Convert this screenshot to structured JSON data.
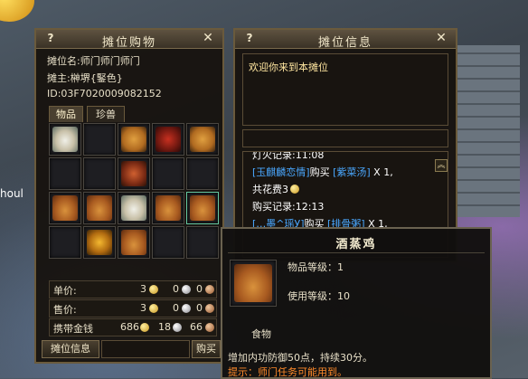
{
  "background_text": "houl",
  "shop": {
    "title": "摊位购物",
    "name_label": "摊位名:",
    "name_value": "师门师门师门",
    "owner_label": "摊主:",
    "owner_value": "榊堺{鋻色}",
    "id_text": "ID:03F7020009082152",
    "tabs": [
      "物品",
      "珍兽"
    ],
    "price_label": "单价:",
    "price_values": [
      "3",
      "0",
      "0"
    ],
    "sell_label": "售价:",
    "sell_values": [
      "3",
      "0",
      "0"
    ],
    "money_label": "携带金钱",
    "money_values": [
      "686",
      "18",
      "66"
    ],
    "stall_info_button": "摊位信息",
    "buy_button": "购买"
  },
  "info": {
    "title": "摊位信息",
    "welcome": "欢迎你来到本摊位",
    "log_lines": [
      {
        "parts": [
          {
            "t": "灯火记录:11:08",
            "c": "white"
          }
        ]
      },
      {
        "parts": [
          {
            "t": "[玉麒麟恋情]",
            "c": "blue"
          },
          {
            "t": "购买 ",
            "c": "white"
          },
          {
            "t": "[紫菜汤]",
            "c": "blue"
          },
          {
            "t": " X 1,",
            "c": "white"
          }
        ]
      },
      {
        "parts": [
          {
            "t": "共花费3",
            "c": "white"
          }
        ]
      },
      {
        "parts": [
          {
            "t": "购买记录:12:13",
            "c": "white"
          }
        ]
      },
      {
        "parts": [
          {
            "t": "[…墨^瑶У]",
            "c": "blue"
          },
          {
            "t": "购买 ",
            "c": "white"
          },
          {
            "t": "[排骨粥]",
            "c": "blue"
          },
          {
            "t": " X 1,",
            "c": "white"
          }
        ]
      }
    ]
  },
  "tooltip": {
    "title": "酒蒸鸡",
    "item_level_label": "物品等级：",
    "item_level": "1",
    "use_level_label": "使用等级：",
    "use_level": "10",
    "category": "食物",
    "desc": "增加内功防御50点，持续30分。",
    "hint": "提示：师门任务可能用到。"
  },
  "grid_items": [
    "bowl",
    "",
    "fish",
    "red",
    "fish",
    "",
    "",
    "skewer",
    "",
    "",
    "chicken",
    "chicken",
    "bowl",
    "chicken",
    "chicken",
    "",
    "soup",
    "chicken",
    "",
    ""
  ],
  "colors": {
    "accent": "#6a5a3c",
    "link": "#4aa8ff",
    "hint": "#ff8a2a"
  }
}
